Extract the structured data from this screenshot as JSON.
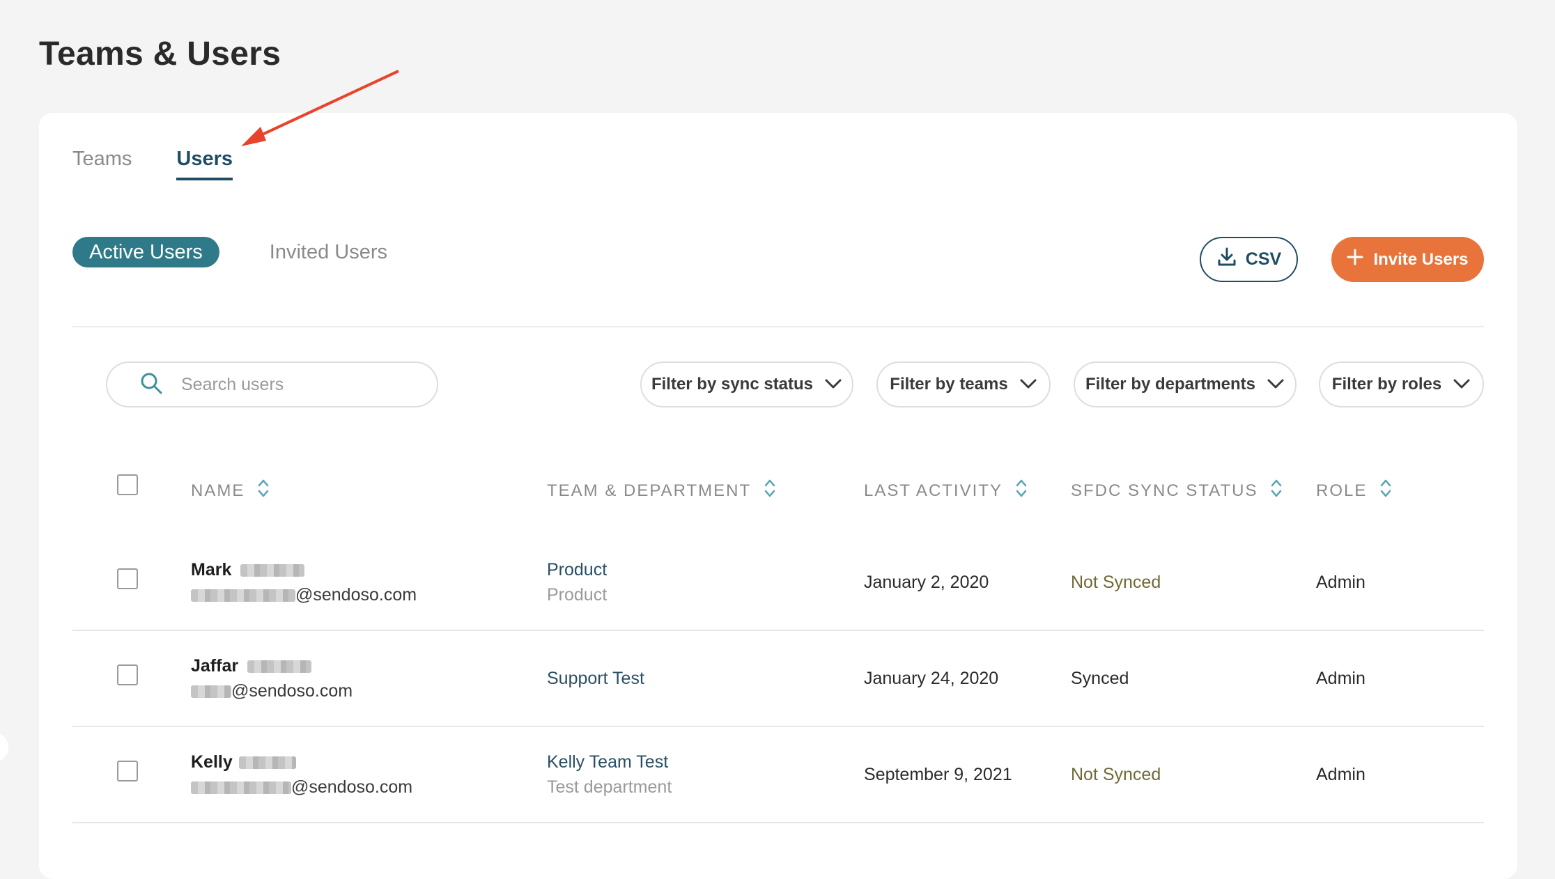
{
  "page": {
    "title": "Teams & Users"
  },
  "tabs": [
    {
      "label": "Teams",
      "active": false
    },
    {
      "label": "Users",
      "active": true
    }
  ],
  "segments": {
    "active": "Active Users",
    "inactive": "Invited Users"
  },
  "actions": {
    "csv": "CSV",
    "invite": "Invite Users"
  },
  "search": {
    "placeholder": "Search users",
    "value": ""
  },
  "filters": [
    {
      "label": "Filter by sync status"
    },
    {
      "label": "Filter by teams"
    },
    {
      "label": "Filter by departments"
    },
    {
      "label": "Filter by roles"
    }
  ],
  "table": {
    "headers": [
      "NAME",
      "TEAM & DEPARTMENT",
      "LAST ACTIVITY",
      "SFDC SYNC STATUS",
      "ROLE"
    ],
    "rows": [
      {
        "first_name": "Mark",
        "email_domain": "@sendoso.com",
        "team": "Product",
        "department": "Product",
        "last_activity": "January 2, 2020",
        "sync_status": "Not Synced",
        "role": "Admin"
      },
      {
        "first_name": "Jaffar",
        "email_domain": "@sendoso.com",
        "team": "Support Test",
        "department": "",
        "last_activity": "January 24, 2020",
        "sync_status": "Synced",
        "role": "Admin"
      },
      {
        "first_name": "Kelly",
        "email_domain": "@sendoso.com",
        "team": "Kelly Team Test",
        "department": "Test department",
        "last_activity": "September 9, 2021",
        "sync_status": "Not Synced",
        "role": "Admin"
      }
    ]
  },
  "colors": {
    "primary": "#1f4d63",
    "teal": "#2f7a89",
    "accent": "#e8743b",
    "annotation": "#e8432b",
    "not_synced": "#6f6a35"
  },
  "icons": {
    "search": "search-icon",
    "download": "download-icon",
    "plus": "plus-icon",
    "chevron": "chevron-down-icon",
    "sort": "sort-icon"
  }
}
